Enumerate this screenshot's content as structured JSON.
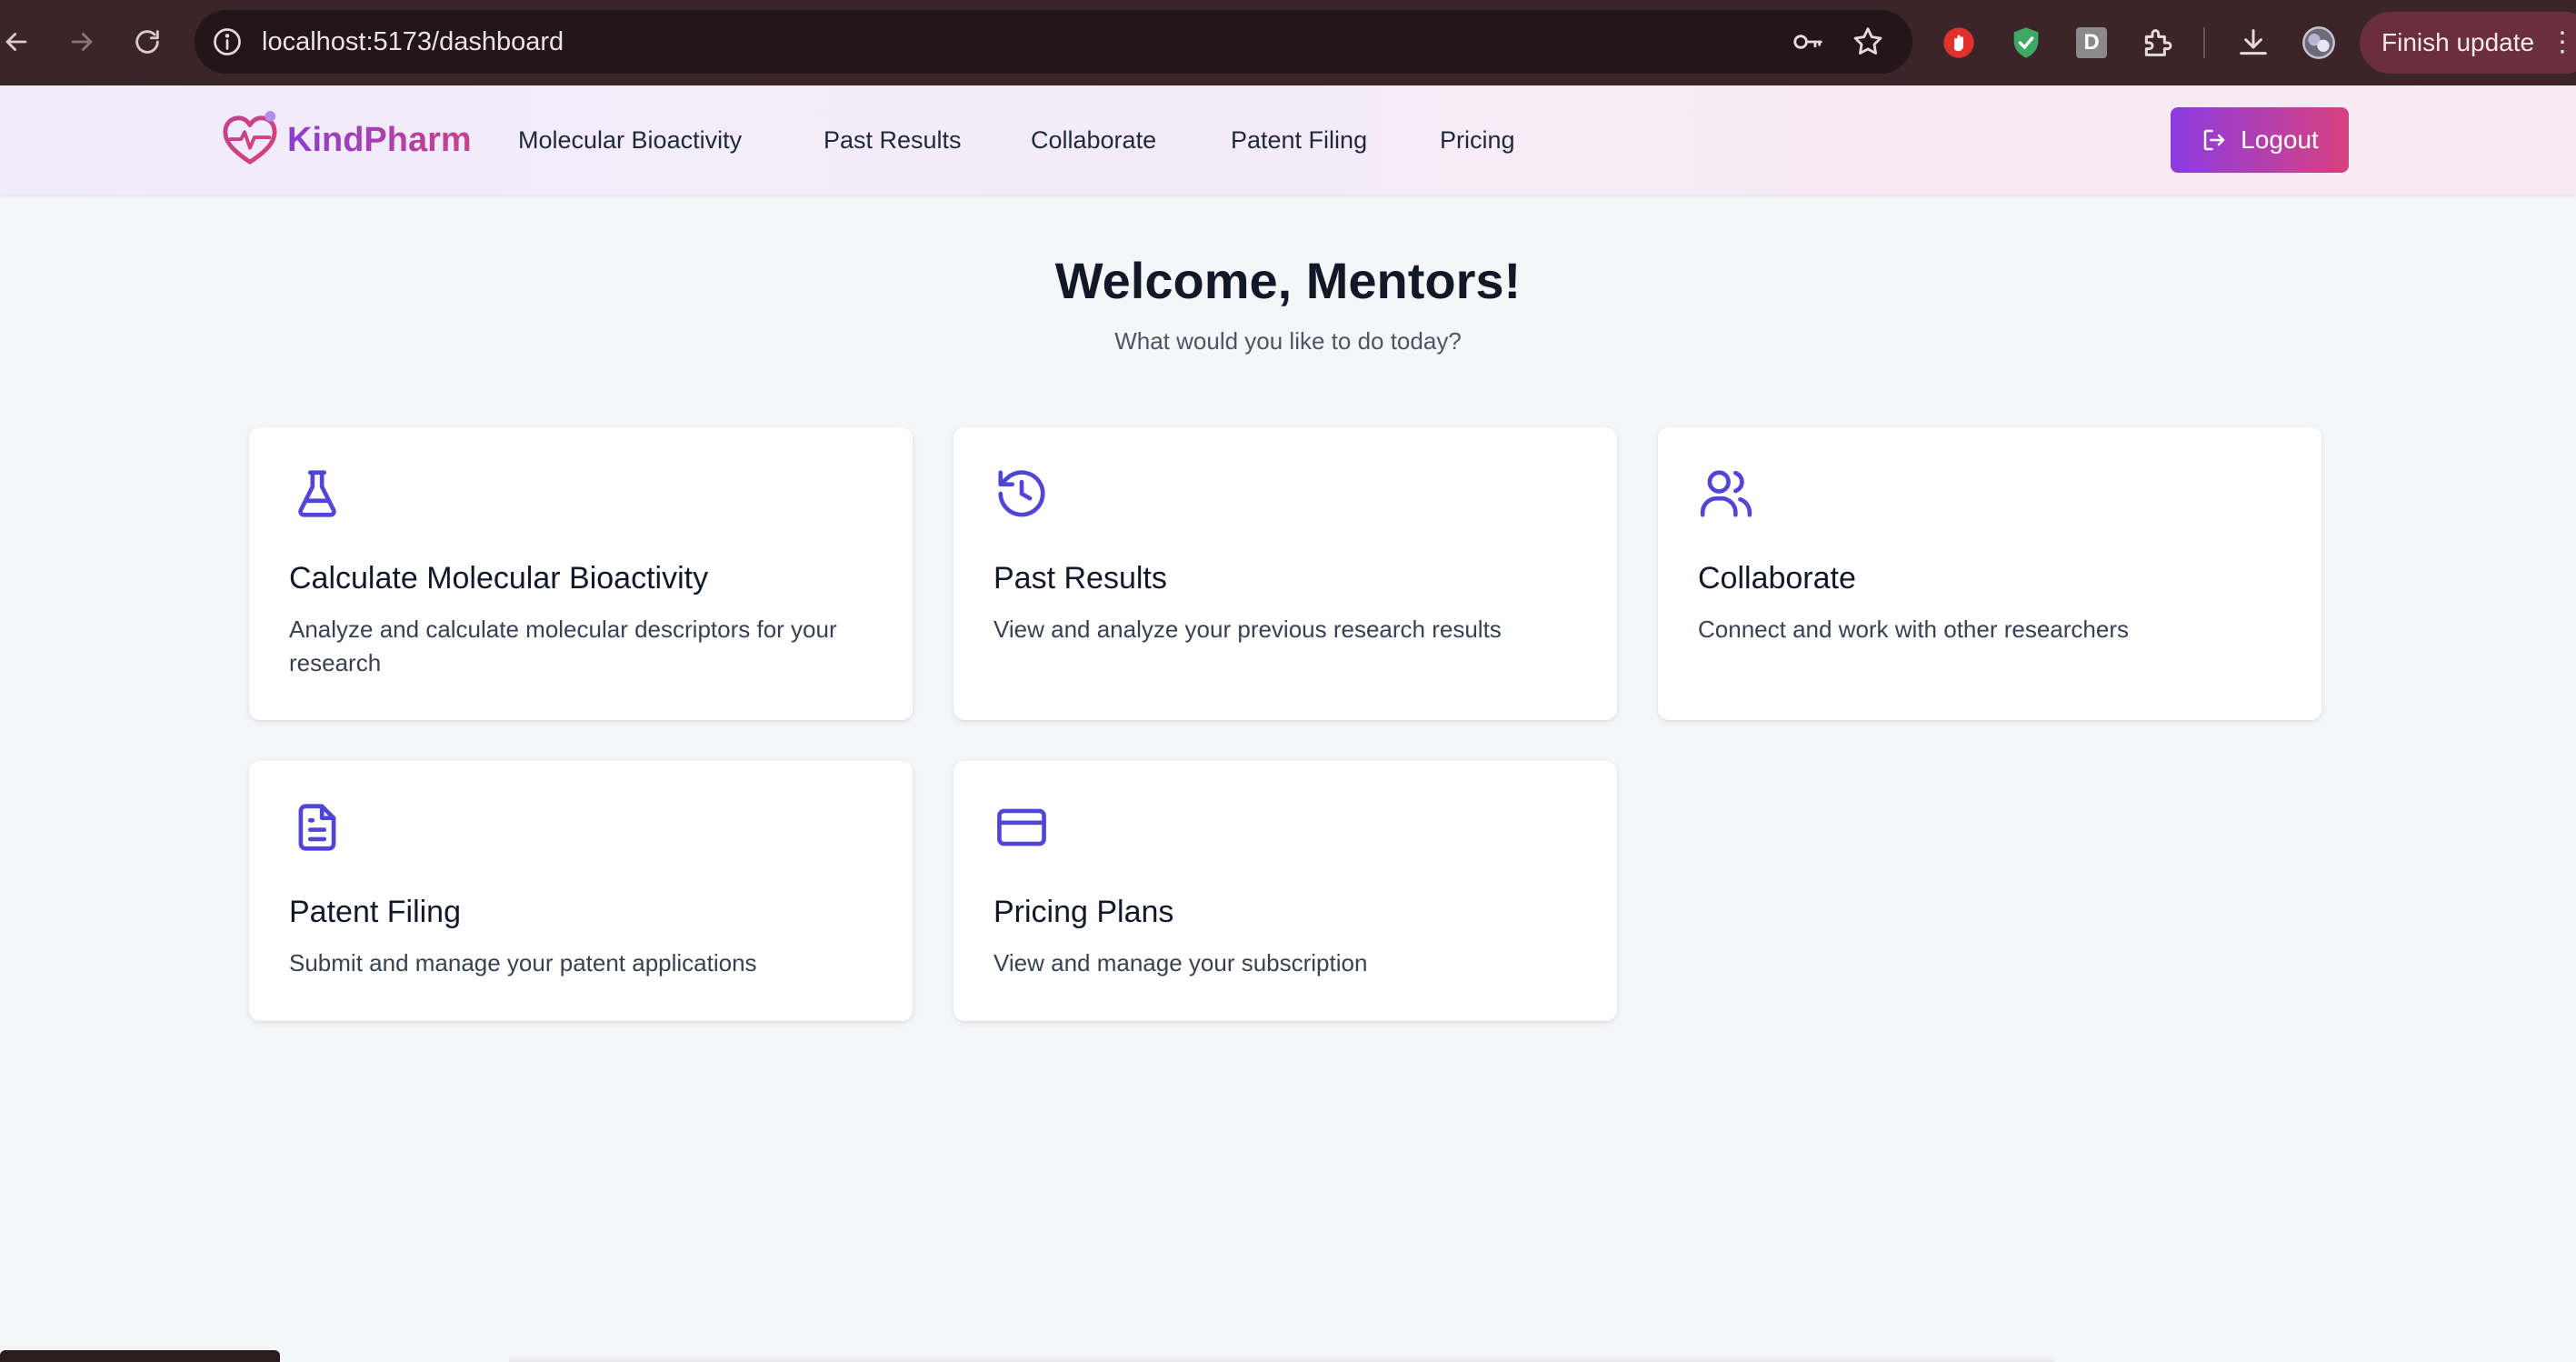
{
  "browser": {
    "url": "localhost:5173/dashboard",
    "finish_update_label": "Finish update",
    "extension_d_letter": "D"
  },
  "header": {
    "brand_name": "KindPharm",
    "nav": [
      {
        "label": "Molecular Bioactivity"
      },
      {
        "label": "Past Results"
      },
      {
        "label": "Collaborate"
      },
      {
        "label": "Patent Filing"
      },
      {
        "label": "Pricing"
      }
    ],
    "logout_label": "Logout"
  },
  "main": {
    "welcome": "Welcome, Mentors!",
    "subtitle": "What would you like to do today?",
    "cards": [
      {
        "icon": "flask-icon",
        "title": "Calculate Molecular Bioactivity",
        "description": "Analyze and calculate molecular descriptors for your research"
      },
      {
        "icon": "history-icon",
        "title": "Past Results",
        "description": "View and analyze your previous research results"
      },
      {
        "icon": "users-icon",
        "title": "Collaborate",
        "description": "Connect and work with other researchers"
      },
      {
        "icon": "document-icon",
        "title": "Patent Filing",
        "description": "Submit and manage your patent applications"
      },
      {
        "icon": "credit-card-icon",
        "title": "Pricing Plans",
        "description": "View and manage your subscription"
      }
    ]
  },
  "colors": {
    "accent": "#5145d8",
    "brand_gradient_start": "#8a3fcf",
    "brand_gradient_end": "#c8428c",
    "logout_gradient_start": "#8b3be0",
    "logout_gradient_end": "#d7427f"
  }
}
